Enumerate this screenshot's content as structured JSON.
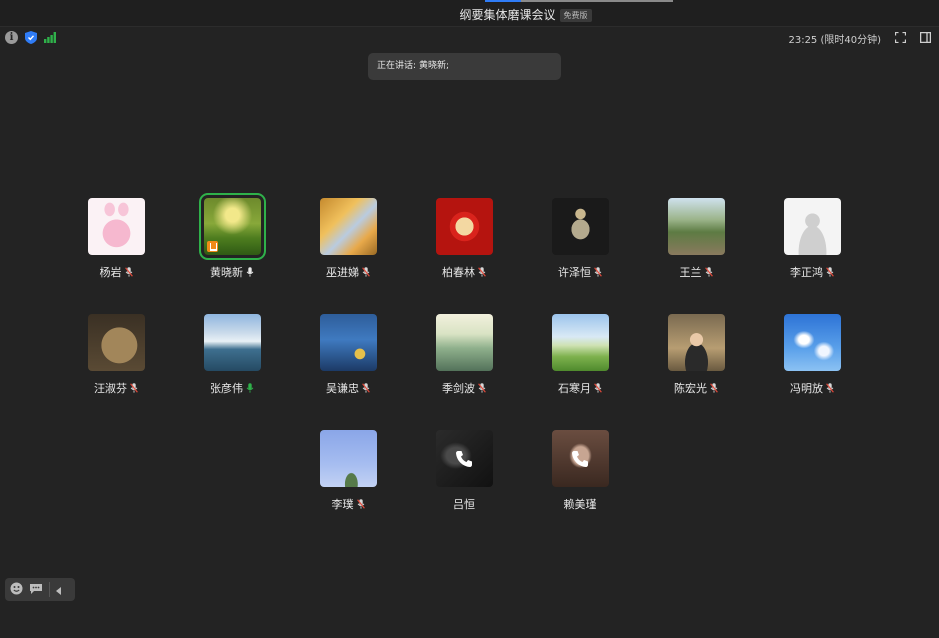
{
  "window": {
    "title": "纲要集体磨课会议",
    "edition_badge": "免费版"
  },
  "status": {
    "time_text": "23:25 (限时40分钟)",
    "icons": [
      "info-icon",
      "shield-icon",
      "signal-icon"
    ]
  },
  "speaking": {
    "prefix": "正在讲话:",
    "names": "黄晓新;"
  },
  "participants": [
    {
      "name": "杨岩",
      "mic": "muted",
      "avatar": "pink-bunny"
    },
    {
      "name": "黄晓新",
      "mic": "on",
      "avatar": "moss-forest",
      "active": true
    },
    {
      "name": "巫进娣",
      "mic": "muted",
      "avatar": "golden-fish"
    },
    {
      "name": "柏春林",
      "mic": "muted",
      "avatar": "spring-red"
    },
    {
      "name": "许泽恒",
      "mic": "muted",
      "avatar": "statue-dark"
    },
    {
      "name": "王兰",
      "mic": "muted",
      "avatar": "park-scene"
    },
    {
      "name": "李正鸿",
      "mic": "muted",
      "avatar": "default-person"
    },
    {
      "name": "汪淑芬",
      "mic": "muted",
      "avatar": "capybara"
    },
    {
      "name": "张彦伟",
      "mic": "speaking",
      "avatar": "waterfall"
    },
    {
      "name": "吴谦忠",
      "mic": "muted",
      "avatar": "sea-rocks"
    },
    {
      "name": "季剑波",
      "mic": "muted",
      "avatar": "tea-landscape"
    },
    {
      "name": "石寒月",
      "mic": "muted",
      "avatar": "green-field"
    },
    {
      "name": "陈宏光",
      "mic": "muted",
      "avatar": "child-photo"
    },
    {
      "name": "冯明放",
      "mic": "muted",
      "avatar": "blue-sky"
    },
    {
      "name": "李璞",
      "mic": "muted",
      "avatar": "sky-tree"
    },
    {
      "name": "吕恒",
      "mic": "phone",
      "avatar": "dark-silhouette"
    },
    {
      "name": "赖美瑾",
      "mic": "phone",
      "avatar": "girl-hair"
    }
  ],
  "colors": {
    "background": "#232323",
    "active_outline": "#2fb14a",
    "mic_muted": "#e24a3b",
    "mic_speaking": "#2fb14a",
    "tab_accent": "#2f7cf6"
  }
}
